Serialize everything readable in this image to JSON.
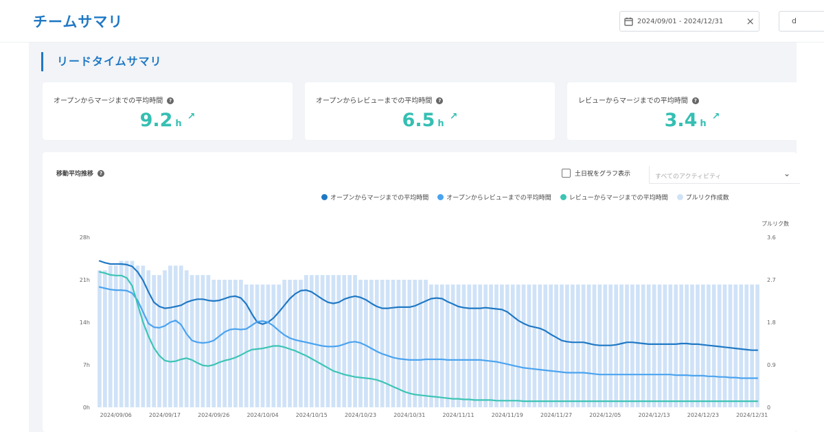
{
  "header": {
    "title": "チームサマリ",
    "date_range": "2024/09/01 - 2024/12/31",
    "clear_icon": "×",
    "select_partial": "d"
  },
  "section": {
    "title": "リードタイムサマリ"
  },
  "stats": [
    {
      "label": "オープンからマージまでの平均時間",
      "value": "9.2",
      "unit": "h",
      "trend": "up"
    },
    {
      "label": "オープンからレビューまでの平均時間",
      "value": "6.5",
      "unit": "h",
      "trend": "up"
    },
    {
      "label": "レビューからマージまでの平均時間",
      "value": "3.4",
      "unit": "h",
      "trend": "up"
    }
  ],
  "chart_panel": {
    "title": "移動平均推移",
    "weekend_label": "土日祝をグラフ表示",
    "activity_placeholder": "すべてのアクティビティ"
  },
  "colors": {
    "accent": "#1f78c4",
    "teal": "#35bfb2",
    "series1": "#1f78c4",
    "series2": "#4aa3ef",
    "series3": "#3cc4b4",
    "bars": "#cfe2f7"
  },
  "chart_data": {
    "type": "bar+line",
    "legend_placement": "top-right",
    "grid": false,
    "y_left": {
      "ticks": [
        "28h",
        "21h",
        "14h",
        "7h",
        "0h"
      ],
      "range": [
        0,
        28
      ]
    },
    "y_right": {
      "label": "プルリク数",
      "ticks": [
        "3.6",
        "2.7",
        "1.8",
        "0.9",
        "0"
      ],
      "range": [
        0,
        3.6
      ]
    },
    "x_ticks": [
      "2024/09/06",
      "2024/09/17",
      "2024/09/26",
      "2024/10/04",
      "2024/10/15",
      "2024/10/23",
      "2024/10/31",
      "2024/11/11",
      "2024/11/19",
      "2024/11/27",
      "2024/12/05",
      "2024/12/13",
      "2024/12/23",
      "2024/12/31"
    ],
    "x_tick_index": [
      3,
      12,
      21,
      30,
      39,
      48,
      57,
      66,
      75,
      84,
      93,
      102,
      111,
      120
    ],
    "x_count": 122,
    "series": [
      {
        "name": "オープンからマージまでの平均時間",
        "values": [
          24.1,
          23.8,
          23.6,
          23.6,
          23.6,
          23.5,
          23.2,
          22.3,
          20.9,
          19.0,
          17.3,
          16.6,
          16.3,
          16.4,
          16.6,
          16.8,
          17.3,
          17.6,
          17.8,
          17.8,
          17.6,
          17.5,
          17.6,
          17.9,
          18.2,
          18.3,
          18.0,
          17.0,
          15.4,
          14.0,
          13.7,
          14.0,
          14.7,
          15.7,
          16.8,
          17.9,
          18.7,
          19.2,
          19.3,
          19.0,
          18.4,
          17.8,
          17.3,
          17.1,
          17.3,
          17.8,
          18.1,
          18.3,
          18.1,
          17.7,
          17.1,
          16.6,
          16.3,
          16.3,
          16.4,
          16.5,
          16.5,
          16.5,
          16.7,
          17.1,
          17.5,
          17.9,
          18.0,
          17.9,
          17.4,
          17.0,
          16.6,
          16.4,
          16.3,
          16.3,
          16.3,
          16.4,
          16.3,
          16.2,
          16.1,
          15.7,
          15.0,
          14.3,
          13.8,
          13.4,
          13.2,
          13.0,
          12.6,
          12.0,
          11.5,
          11.0,
          10.8,
          10.7,
          10.7,
          10.7,
          10.5,
          10.3,
          10.2,
          10.2,
          10.2,
          10.3,
          10.5,
          10.7,
          10.7,
          10.6,
          10.5,
          10.4,
          10.4,
          10.4,
          10.4,
          10.4,
          10.4,
          10.5,
          10.5,
          10.4,
          10.4,
          10.3,
          10.2,
          10.1,
          10.0,
          9.9,
          9.8,
          9.7,
          9.6,
          9.5,
          9.4,
          9.4
        ]
      },
      {
        "name": "オープンからレビューまでの平均時間",
        "values": [
          19.8,
          19.6,
          19.4,
          19.3,
          19.3,
          19.2,
          18.8,
          17.6,
          15.7,
          13.8,
          13.2,
          13.1,
          13.4,
          14.0,
          14.3,
          13.6,
          12.1,
          11.0,
          10.7,
          10.6,
          10.7,
          11.0,
          11.7,
          12.4,
          12.8,
          12.9,
          12.8,
          12.9,
          13.5,
          14.1,
          14.2,
          14.0,
          13.4,
          12.6,
          11.9,
          11.4,
          11.1,
          10.9,
          10.7,
          10.5,
          10.3,
          10.1,
          10.0,
          10.0,
          10.1,
          10.4,
          10.7,
          10.8,
          10.6,
          10.2,
          9.7,
          9.2,
          8.8,
          8.5,
          8.2,
          8.0,
          7.9,
          7.8,
          7.8,
          7.8,
          7.9,
          7.9,
          7.9,
          7.9,
          7.8,
          7.8,
          7.8,
          7.8,
          7.8,
          7.8,
          7.8,
          7.7,
          7.6,
          7.5,
          7.3,
          7.1,
          6.9,
          6.7,
          6.5,
          6.4,
          6.3,
          6.2,
          6.1,
          6.0,
          5.9,
          5.8,
          5.7,
          5.7,
          5.7,
          5.7,
          5.6,
          5.5,
          5.4,
          5.4,
          5.4,
          5.4,
          5.4,
          5.4,
          5.4,
          5.4,
          5.4,
          5.4,
          5.4,
          5.4,
          5.4,
          5.4,
          5.3,
          5.3,
          5.3,
          5.2,
          5.2,
          5.2,
          5.1,
          5.1,
          5.0,
          5.0,
          4.9,
          4.9,
          4.8,
          4.8,
          4.8,
          4.8
        ]
      },
      {
        "name": "レビューからマージまでの平均時間",
        "values": [
          22.3,
          22.1,
          21.8,
          21.7,
          21.7,
          21.3,
          20.0,
          17.0,
          14.0,
          11.7,
          9.8,
          8.5,
          7.7,
          7.5,
          7.6,
          7.9,
          8.1,
          7.8,
          7.3,
          6.9,
          6.8,
          7.0,
          7.4,
          7.7,
          7.9,
          8.2,
          8.6,
          9.1,
          9.5,
          9.6,
          9.7,
          9.9,
          10.1,
          10.1,
          9.9,
          9.6,
          9.3,
          8.9,
          8.5,
          8.0,
          7.5,
          7.0,
          6.5,
          6.0,
          5.7,
          5.4,
          5.2,
          5.0,
          4.9,
          4.8,
          4.7,
          4.5,
          4.2,
          3.8,
          3.4,
          3.0,
          2.6,
          2.3,
          2.1,
          2.0,
          1.9,
          1.8,
          1.7,
          1.6,
          1.5,
          1.4,
          1.4,
          1.3,
          1.3,
          1.2,
          1.2,
          1.2,
          1.2,
          1.1,
          1.1,
          1.1,
          1.1,
          1.1,
          1.0,
          1.0,
          1.0,
          1.0,
          1.0,
          1.0,
          1.0,
          1.0,
          1.0,
          1.0,
          1.0,
          1.0,
          1.0,
          1.0,
          1.0,
          1.0,
          1.0,
          1.0,
          1.0,
          1.0,
          1.0,
          1.0,
          1.0,
          1.0,
          1.0,
          1.0,
          1.0,
          1.0,
          1.0,
          1.0,
          1.0,
          1.0,
          1.0,
          1.0,
          1.0,
          1.0,
          1.0,
          1.0,
          1.0,
          1.0,
          1.0,
          1.0,
          1.0,
          1.0
        ]
      },
      {
        "name": "プルリク作成数",
        "values": [
          2.9,
          2.9,
          3.0,
          3.0,
          3.1,
          3.1,
          3.1,
          3.0,
          3.0,
          2.9,
          2.8,
          2.8,
          2.9,
          3.0,
          3.0,
          3.0,
          2.9,
          2.8,
          2.8,
          2.8,
          2.8,
          2.7,
          2.7,
          2.7,
          2.7,
          2.7,
          2.7,
          2.6,
          2.6,
          2.6,
          2.6,
          2.6,
          2.6,
          2.6,
          2.7,
          2.7,
          2.7,
          2.7,
          2.8,
          2.8,
          2.8,
          2.8,
          2.8,
          2.8,
          2.8,
          2.8,
          2.8,
          2.8,
          2.7,
          2.7,
          2.7,
          2.7,
          2.7,
          2.7,
          2.7,
          2.7,
          2.7,
          2.7,
          2.7,
          2.7,
          2.7,
          2.6,
          2.6,
          2.6,
          2.6,
          2.6,
          2.6,
          2.6,
          2.6,
          2.6,
          2.6,
          2.6,
          2.6,
          2.6,
          2.6,
          2.6,
          2.6,
          2.6,
          2.6,
          2.6,
          2.6,
          2.6,
          2.6,
          2.6,
          2.6,
          2.6,
          2.6,
          2.6,
          2.6,
          2.6,
          2.6,
          2.6,
          2.6,
          2.6,
          2.6,
          2.6,
          2.6,
          2.6,
          2.6,
          2.6,
          2.6,
          2.6,
          2.6,
          2.6,
          2.6,
          2.6,
          2.6,
          2.6,
          2.6,
          2.6,
          2.6,
          2.6,
          2.6,
          2.6,
          2.6,
          2.6,
          2.6,
          2.6,
          2.6,
          2.6,
          2.6,
          2.6
        ]
      }
    ]
  }
}
